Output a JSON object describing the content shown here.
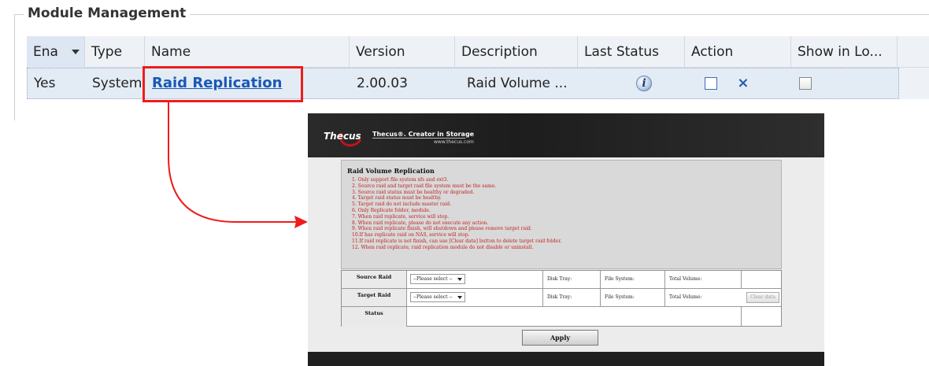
{
  "module_panel": {
    "title": "Module Management",
    "columns": [
      "Ena",
      "Type",
      "Name",
      "Version",
      "Description",
      "Last Status",
      "Action",
      "Show in Lo..."
    ],
    "row": {
      "enabled": "Yes",
      "type": "System",
      "name": "Raid Replication",
      "version": "2.00.03",
      "description": "Raid Volume ...",
      "action_delete": "×"
    }
  },
  "thecus_window": {
    "brand": "Thecus",
    "tagline": "Thecus®. Creator in Storage",
    "url": "www.thecus.com",
    "title": "Raid Volume Replication",
    "rules": [
      "1. Only support file system xfs and ext3.",
      "2. Source raid and target raid file system must be the same.",
      "3. Source raid status must be healthy or degraded.",
      "4. Target raid status must be healthy.",
      "5. Target raid do not include master raid.",
      "6. Only Replicate folder, module.",
      "7. When raid replicate, service will stop.",
      "8. When raid replicate, please do not execute any action.",
      "9. When raid replicate finish, will shutdown and please remove target raid.",
      "10.If has replicate raid on NAS, service will stop.",
      "11.If raid replicate is not finish, can use [Clear data] button to delete target raid folder.",
      "12. When raid replicate, raid replication module do not disable or uninstall."
    ],
    "source_raid_label": "Source Raid",
    "target_raid_label": "Target Raid",
    "status_label": "Status",
    "select_placeholder": "--Please select --",
    "disk_tray_label": "Disk Tray:",
    "file_system_label": "File System:",
    "total_volume_label": "Total Volume:",
    "clear_data_button": "Clear data",
    "apply_button": "Apply"
  },
  "colors": {
    "highlight": "#ee1c1c",
    "link": "#1a58b5",
    "grid_bg": "#eef2f7",
    "rules_text": "#c02020"
  }
}
